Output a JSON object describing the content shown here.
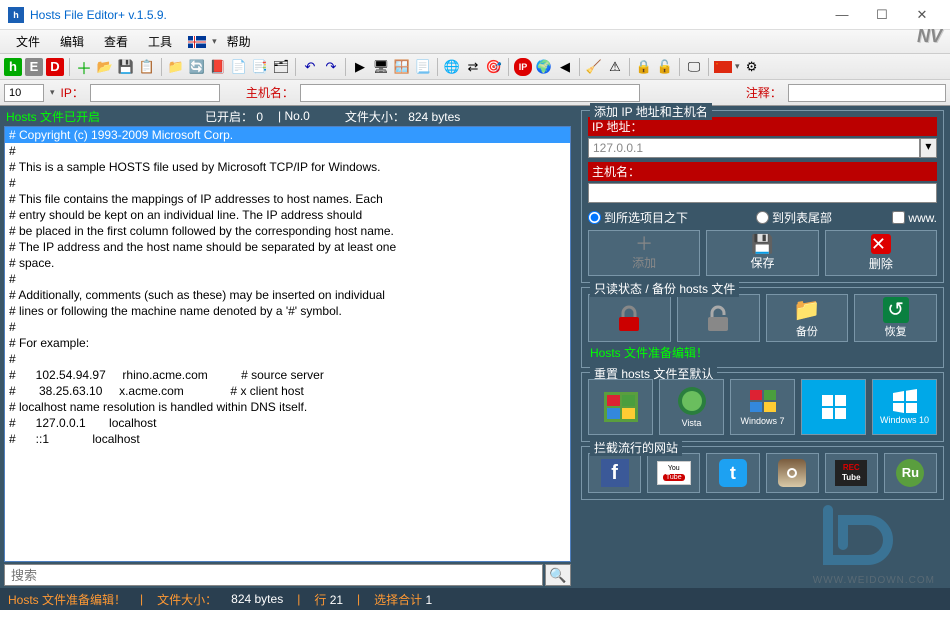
{
  "window": {
    "title": "Hosts File Editor+  v.1.5.9."
  },
  "menu": {
    "file": "文件",
    "edit": "编辑",
    "view": "查看",
    "tools": "工具",
    "help": "帮助"
  },
  "toolbar2": {
    "count": "10",
    "ip_label": "IP：",
    "host_label": "主机名：",
    "comment_label": "注释："
  },
  "topstatus": {
    "hosts_status": "Hosts 文件已开启",
    "opened": "已开启： 0",
    "no": "| No.0",
    "size_label": "文件大小：",
    "size": "824 bytes"
  },
  "editor_lines": [
    "# Copyright (c) 1993-2009 Microsoft Corp.",
    "#",
    "# This is a sample HOSTS file used by Microsoft TCP/IP for Windows.",
    "#",
    "# This file contains the mappings of IP addresses to host names. Each",
    "# entry should be kept on an individual line. The IP address should",
    "# be placed in the first column followed by the corresponding host name.",
    "# The IP address and the host name should be separated by at least one",
    "# space.",
    "#",
    "# Additionally, comments (such as these) may be inserted on individual",
    "# lines or following the machine name denoted by a '#' symbol.",
    "#",
    "# For example:",
    "#",
    "#      102.54.94.97     rhino.acme.com          # source server",
    "#       38.25.63.10     x.acme.com              # x client host",
    "",
    "# localhost name resolution is handled within DNS itself.",
    "#\t127.0.0.1       localhost",
    "#\t::1             localhost"
  ],
  "search": {
    "placeholder": "搜索"
  },
  "rightpanel": {
    "group1_title": "添加 IP 地址和主机名",
    "ip_label": "IP 地址：",
    "ip_value": "127.0.0.1",
    "host_label": "主机名：",
    "host_value": "",
    "radio_below": "到所选项目之下",
    "radio_end": "到列表尾部",
    "cb_www": "www.",
    "btn_add": "添加",
    "btn_save": "保存",
    "btn_delete": "删除",
    "group2_title": "只读状态 / 备份 hosts 文件",
    "btn_backup": "备份",
    "btn_restore": "恢复",
    "ready_status": "Hosts 文件准备编辑！",
    "group3_title": "重置 hosts 文件至默认",
    "os_vista": "Vista",
    "os_win7": "Windows 7",
    "os_win10": "Windows 10",
    "group4_title": "拦截流行的网站"
  },
  "footer": {
    "ready": "Hosts 文件准备编辑！",
    "size_label": "文件大小：",
    "size_val": "824 bytes",
    "line_label": "行",
    "line_val": "21",
    "sel_label": "选择合计",
    "sel_val": "1"
  },
  "watermark_text": "WWW.WEIDOWN.COM"
}
